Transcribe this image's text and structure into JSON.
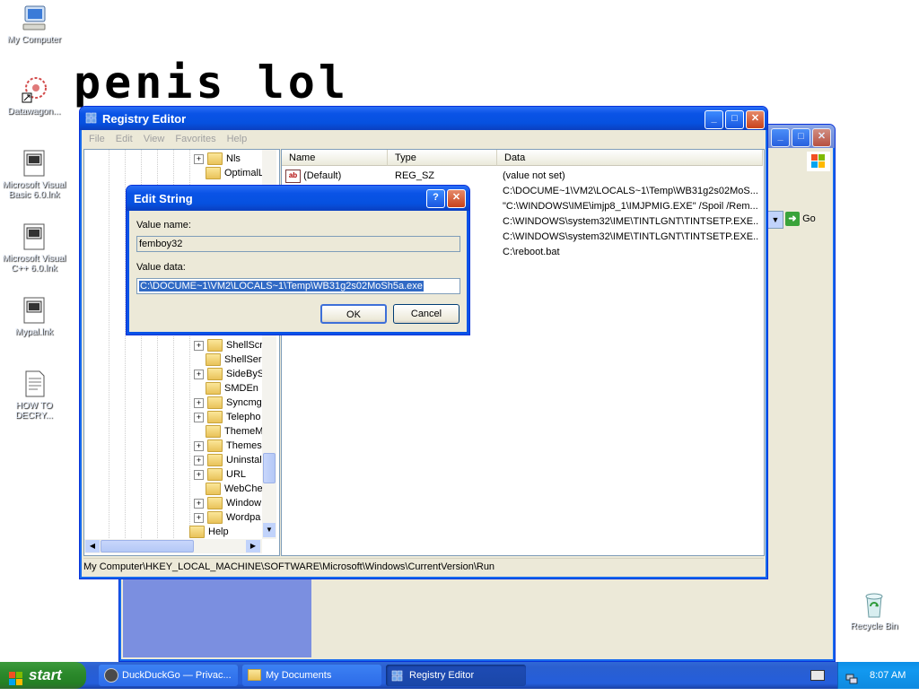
{
  "desktop": {
    "icons": [
      {
        "label": "My Computer"
      },
      {
        "label": "Datawagon..."
      },
      {
        "label": "Microsoft Visual Basic 6.0.lnk"
      },
      {
        "label": "Microsoft Visual C++ 6.0.lnk"
      },
      {
        "label": "Mypal.lnk"
      },
      {
        "label": "HOW TO DECRY..."
      },
      {
        "label": "Recycle Bin"
      }
    ],
    "overlay_text": "penis lol"
  },
  "back_window": {
    "go_label": "Go"
  },
  "registry": {
    "title": "Registry Editor",
    "menu": [
      "File",
      "Edit",
      "View",
      "Favorites",
      "Help"
    ],
    "tree": [
      {
        "label": "Nls",
        "expand": "+"
      },
      {
        "label": "OptimalL",
        "expand": ""
      },
      {
        "label": "ShellScr",
        "expand": "+"
      },
      {
        "label": "ShellSer",
        "expand": ""
      },
      {
        "label": "SideByS",
        "expand": "+"
      },
      {
        "label": "SMDEn",
        "expand": ""
      },
      {
        "label": "Syncmgr",
        "expand": "+"
      },
      {
        "label": "Telepho",
        "expand": "+"
      },
      {
        "label": "ThemeM",
        "expand": ""
      },
      {
        "label": "Themes",
        "expand": "+"
      },
      {
        "label": "Uninstal",
        "expand": "+"
      },
      {
        "label": "URL",
        "expand": "+"
      },
      {
        "label": "WebChe",
        "expand": ""
      },
      {
        "label": "Window",
        "expand": "+"
      },
      {
        "label": "Wordpa",
        "expand": "+"
      },
      {
        "label": "Help",
        "expand": ""
      }
    ],
    "columns": {
      "name": "Name",
      "type": "Type",
      "data": "Data"
    },
    "rows": [
      {
        "name": "(Default)",
        "type": "REG_SZ",
        "data": "(value not set)"
      },
      {
        "name": "",
        "type": "",
        "data": "C:\\DOCUME~1\\VM2\\LOCALS~1\\Temp\\WB31g2s02MoS..."
      },
      {
        "name": "",
        "type": "",
        "data": "\"C:\\WINDOWS\\IME\\imjp8_1\\IMJPMIG.EXE\" /Spoil /Rem..."
      },
      {
        "name": "",
        "type": "",
        "data": "C:\\WINDOWS\\system32\\IME\\TINTLGNT\\TINTSETP.EXE..."
      },
      {
        "name": "",
        "type": "",
        "data": "C:\\WINDOWS\\system32\\IME\\TINTLGNT\\TINTSETP.EXE..."
      },
      {
        "name": "",
        "type": "",
        "data": "C:\\reboot.bat"
      }
    ],
    "status": "My Computer\\HKEY_LOCAL_MACHINE\\SOFTWARE\\Microsoft\\Windows\\CurrentVersion\\Run"
  },
  "dialog": {
    "title": "Edit String",
    "help_glyph": "?",
    "value_name_label": "Value name:",
    "value_name": "femboy32",
    "value_data_label": "Value data:",
    "value_data": "C:\\DOCUME~1\\VM2\\LOCALS~1\\Temp\\WB31g2s02MoSh5a.exe",
    "ok": "OK",
    "cancel": "Cancel"
  },
  "taskbar": {
    "start": "start",
    "tasks": [
      {
        "label": "DuckDuckGo — Privac..."
      },
      {
        "label": "My Documents"
      },
      {
        "label": "Registry Editor"
      }
    ],
    "clock": "8:07 AM"
  }
}
